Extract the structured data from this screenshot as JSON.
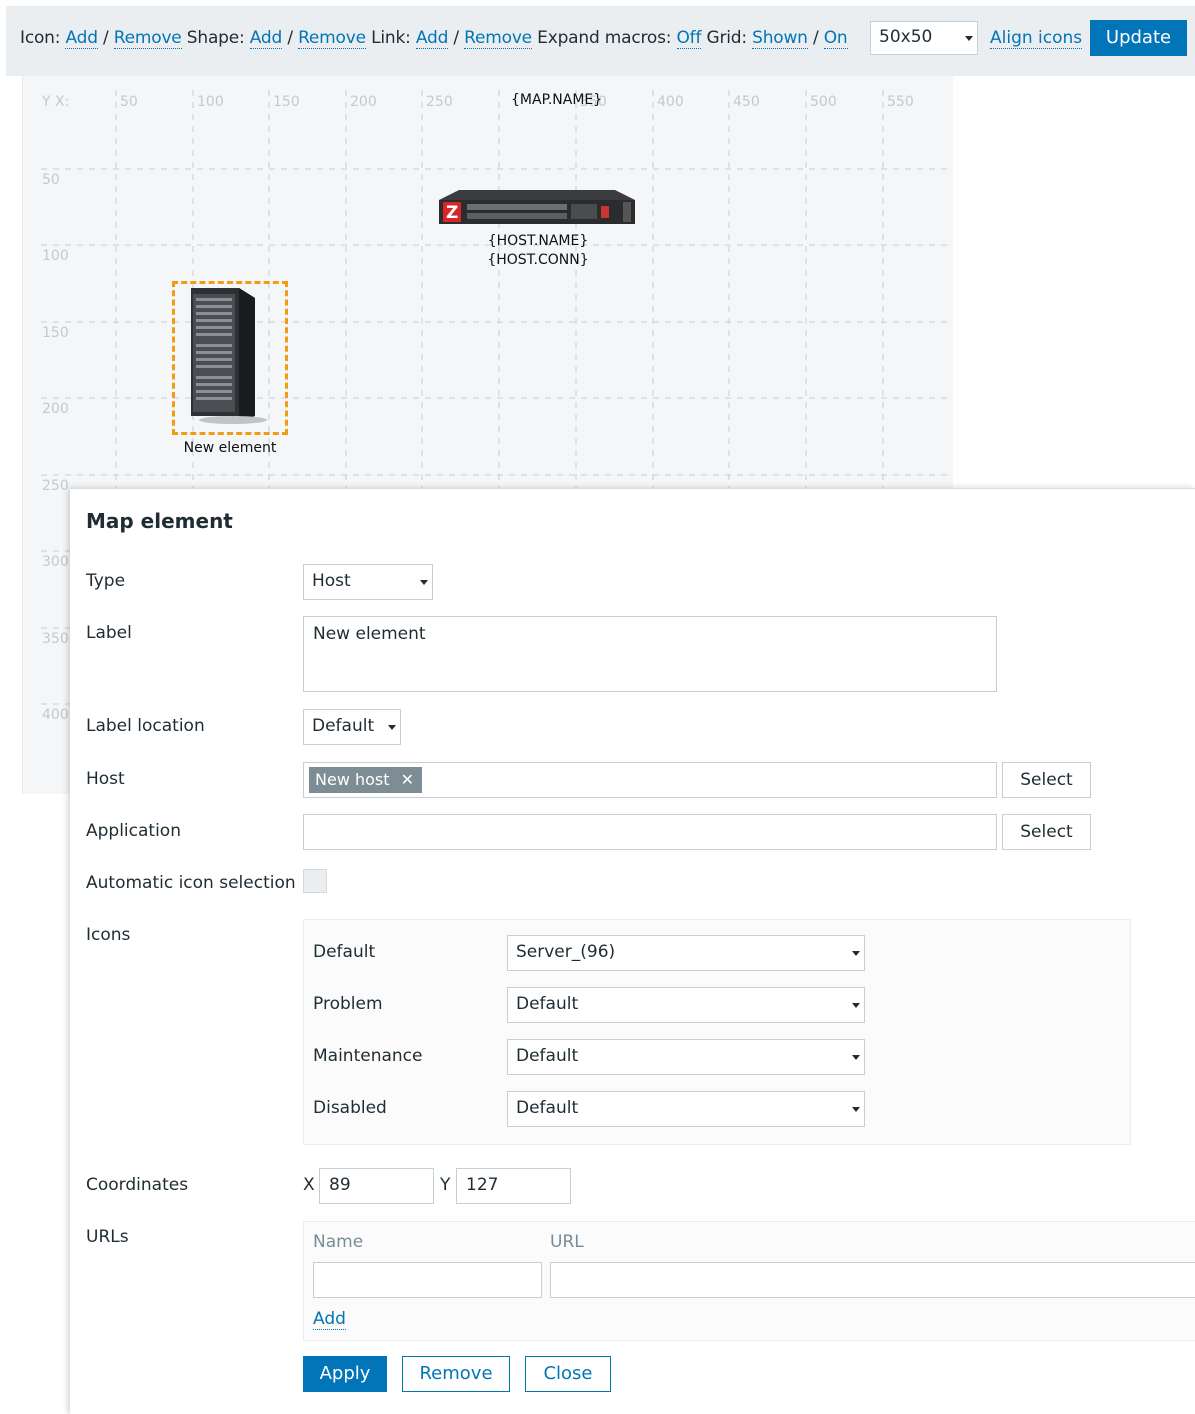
{
  "toolbar": {
    "icon_label": "Icon:",
    "shape_label": "Shape:",
    "link_label": "Link:",
    "add": "Add",
    "remove": "Remove",
    "slash": "/",
    "expand_label": "Expand macros:",
    "expand_value": "Off",
    "grid_label": "Grid:",
    "grid_shown": "Shown",
    "grid_on": "On",
    "grid_size": "50x50",
    "align_icons": "Align icons",
    "update": "Update"
  },
  "map": {
    "corner_label": "Y X:",
    "x_ticks": [
      "50",
      "100",
      "150",
      "200",
      "250",
      "350",
      "400",
      "450",
      "500",
      "550"
    ],
    "y_ticks": [
      "50",
      "100",
      "150",
      "200",
      "250",
      "300",
      "350",
      "400"
    ],
    "name_macro": "{MAP.NAME}",
    "host_element": {
      "line1": "{HOST.NAME}",
      "line2": "{HOST.CONN}"
    },
    "new_element_label": "New element",
    "selection_color": "#f39c12"
  },
  "dialog": {
    "title": "Map element",
    "type_label": "Type",
    "type_value": "Host",
    "label_label": "Label",
    "label_value": "New element",
    "label_location_label": "Label location",
    "label_location_value": "Default",
    "host_label": "Host",
    "host_tag": "New host",
    "select": "Select",
    "application_label": "Application",
    "auto_icon_label": "Automatic icon selection",
    "icons_label": "Icons",
    "icons": [
      {
        "label": "Default",
        "value": "Server_(96)"
      },
      {
        "label": "Problem",
        "value": "Default"
      },
      {
        "label": "Maintenance",
        "value": "Default"
      },
      {
        "label": "Disabled",
        "value": "Default"
      }
    ],
    "coordinates_label": "Coordinates",
    "x_label": "X",
    "x_value": "89",
    "y_label": "Y",
    "y_value": "127",
    "urls_label": "URLs",
    "url_name_header": "Name",
    "url_header": "URL",
    "add": "Add",
    "apply": "Apply",
    "remove": "Remove",
    "close": "Close"
  },
  "colors": {
    "accent": "#0275b8",
    "background": "#ebeef0"
  }
}
